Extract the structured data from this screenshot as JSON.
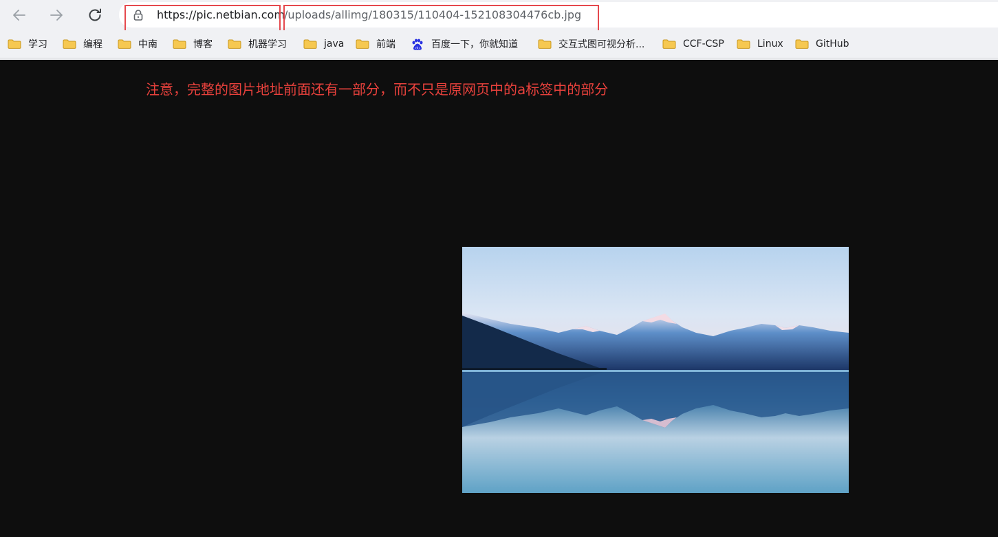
{
  "browser": {
    "url_host": "https://pic.netbian.com",
    "url_path": "/uploads/allimg/180315/110404-152108304476cb.jpg",
    "icons": {
      "back": "arrow-left-icon",
      "forward": "arrow-right-icon",
      "reload": "reload-icon",
      "lock": "lock-icon"
    }
  },
  "bookmarks": [
    {
      "label": "学习",
      "icon": "folder-icon"
    },
    {
      "label": "编程",
      "icon": "folder-icon"
    },
    {
      "label": "中南",
      "icon": "folder-icon"
    },
    {
      "label": "博客",
      "icon": "folder-icon"
    },
    {
      "label": "机器学习",
      "icon": "folder-icon"
    },
    {
      "label": "java",
      "icon": "folder-icon"
    },
    {
      "label": "前端",
      "icon": "folder-icon"
    },
    {
      "label": "百度一下，你就知道",
      "icon": "baidu-icon"
    },
    {
      "label": "交互式图可视分析...",
      "icon": "folder-icon"
    },
    {
      "label": "CCF-CSP",
      "icon": "folder-icon"
    },
    {
      "label": "Linux",
      "icon": "folder-icon"
    },
    {
      "label": "GitHub",
      "icon": "folder-icon"
    }
  ],
  "annotation": {
    "text": "注意，完整的图片地址前面还有一部分，而不只是原网页中的a标签中的部分",
    "color": "#e8413c"
  },
  "colors": {
    "highlight_box": "#e5484d",
    "page_background": "#0e0e0e"
  }
}
